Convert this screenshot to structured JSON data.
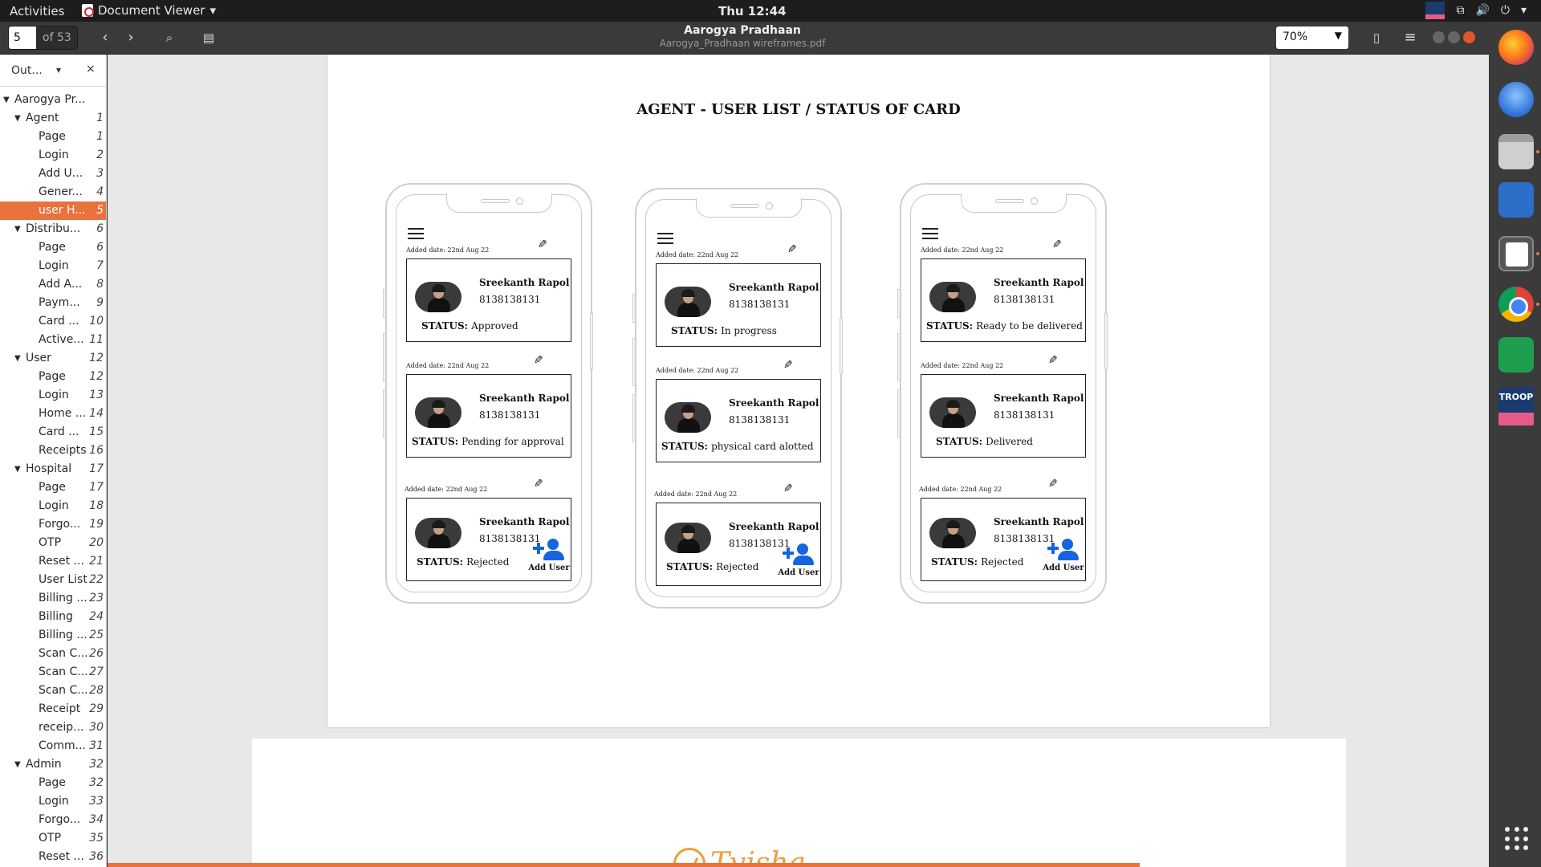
{
  "topbar": {
    "activities": "Activities",
    "app_name": "Document Viewer",
    "clock": "Thu 12:44",
    "tray_troop": "TROOP"
  },
  "header": {
    "page_current": "5",
    "page_of": "of 53",
    "title": "Aarogya Pradhaan",
    "subtitle": "Aarogya_Pradhaan wireframes.pdf",
    "zoom": "70%"
  },
  "sidebar": {
    "label": "Out...",
    "items": [
      {
        "label": "Aarogya Pr...",
        "page": "",
        "level": 0,
        "arrow": true
      },
      {
        "label": "Agent",
        "page": "1",
        "level": 1,
        "arrow": true
      },
      {
        "label": "Page",
        "page": "1",
        "level": 2
      },
      {
        "label": "Login",
        "page": "2",
        "level": 2
      },
      {
        "label": "Add U...",
        "page": "3",
        "level": 2
      },
      {
        "label": "Gener...",
        "page": "4",
        "level": 2
      },
      {
        "label": "user H...",
        "page": "5",
        "level": 2,
        "selected": true
      },
      {
        "label": "Distribu...",
        "page": "6",
        "level": 1,
        "arrow": true
      },
      {
        "label": "Page",
        "page": "6",
        "level": 2
      },
      {
        "label": "Login",
        "page": "7",
        "level": 2
      },
      {
        "label": "Add A...",
        "page": "8",
        "level": 2
      },
      {
        "label": "Paym...",
        "page": "9",
        "level": 2
      },
      {
        "label": "Card ...",
        "page": "10",
        "level": 2
      },
      {
        "label": "Active...",
        "page": "11",
        "level": 2
      },
      {
        "label": "User",
        "page": "12",
        "level": 1,
        "arrow": true
      },
      {
        "label": "Page",
        "page": "12",
        "level": 2
      },
      {
        "label": "Login",
        "page": "13",
        "level": 2
      },
      {
        "label": "Home ...",
        "page": "14",
        "level": 2
      },
      {
        "label": "Card ...",
        "page": "15",
        "level": 2
      },
      {
        "label": "Receipts",
        "page": "16",
        "level": 2
      },
      {
        "label": "Hospital",
        "page": "17",
        "level": 1,
        "arrow": true
      },
      {
        "label": "Page",
        "page": "17",
        "level": 2
      },
      {
        "label": "Login",
        "page": "18",
        "level": 2
      },
      {
        "label": "Forgo...",
        "page": "19",
        "level": 2
      },
      {
        "label": "OTP",
        "page": "20",
        "level": 2
      },
      {
        "label": "Reset ...",
        "page": "21",
        "level": 2
      },
      {
        "label": "User List",
        "page": "22",
        "level": 2
      },
      {
        "label": "Billing ...",
        "page": "23",
        "level": 2
      },
      {
        "label": "Billing",
        "page": "24",
        "level": 2
      },
      {
        "label": "Billing ...",
        "page": "25",
        "level": 2
      },
      {
        "label": "Scan C...",
        "page": "26",
        "level": 2
      },
      {
        "label": "Scan C...",
        "page": "27",
        "level": 2
      },
      {
        "label": "Scan C...",
        "page": "28",
        "level": 2
      },
      {
        "label": "Receipt",
        "page": "29",
        "level": 2
      },
      {
        "label": "receip...",
        "page": "30",
        "level": 2
      },
      {
        "label": "Comm...",
        "page": "31",
        "level": 2
      },
      {
        "label": "Admin",
        "page": "32",
        "level": 1,
        "arrow": true
      },
      {
        "label": "Page",
        "page": "32",
        "level": 2
      },
      {
        "label": "Login",
        "page": "33",
        "level": 2
      },
      {
        "label": "Forgo...",
        "page": "34",
        "level": 2
      },
      {
        "label": "OTP",
        "page": "35",
        "level": 2
      },
      {
        "label": "Reset ...",
        "page": "36",
        "level": 2
      }
    ]
  },
  "document": {
    "page_title": "AGENT - USER LIST / STATUS OF CARD",
    "status_label": "STATUS:",
    "add_user_label": "Add User",
    "phones": [
      {
        "cards": [
          {
            "added": "Added date: 22nd Aug 22",
            "name": "Sreekanth Rapol",
            "phone": "8138138131",
            "status": "Approved",
            "add_user": false
          },
          {
            "added": "Added date: 22nd Aug 22",
            "name": "Sreekanth Rapol",
            "phone": "8138138131",
            "status": "Pending for approval",
            "add_user": false
          },
          {
            "added": "Added date: 22nd Aug 22",
            "name": "Sreekanth Rapol",
            "phone": "8138138131",
            "status": "Rejected",
            "add_user": true
          }
        ]
      },
      {
        "cards": [
          {
            "added": "Added date: 22nd Aug 22",
            "name": "Sreekanth Rapol",
            "phone": "8138138131",
            "status": "In progress",
            "add_user": false
          },
          {
            "added": "Added date: 22nd Aug 22",
            "name": "Sreekanth Rapol",
            "phone": "8138138131",
            "status": "physical card alotted",
            "add_user": false
          },
          {
            "added": "Added date: 22nd Aug 22",
            "name": "Sreekanth Rapol",
            "phone": "8138138131",
            "status": "Rejected",
            "add_user": true
          }
        ]
      },
      {
        "cards": [
          {
            "added": "Added date: 22nd Aug 22",
            "name": "Sreekanth Rapol",
            "phone": "8138138131",
            "status": "Ready to be delivered",
            "add_user": false
          },
          {
            "added": "Added date: 22nd Aug 22",
            "name": "Sreekanth Rapol",
            "phone": "8138138131",
            "status": "Delivered",
            "add_user": false
          },
          {
            "added": "Added date: 22nd Aug 22",
            "name": "Sreekanth Rapol",
            "phone": "8138138131",
            "status": "Rejected",
            "add_user": true
          }
        ]
      }
    ],
    "next_page_logo": "Tvisha"
  },
  "dock": {
    "apps": [
      "firefox-icon",
      "thunderbird-icon",
      "files-icon",
      "writer-icon",
      "document-viewer-icon",
      "chrome-icon",
      "calc-icon",
      "troop-icon"
    ],
    "troop_label": "TROOP"
  },
  "colors": {
    "accent": "#e9723d",
    "add_user_blue": "#1565e0",
    "logo": "#e9a03c"
  }
}
